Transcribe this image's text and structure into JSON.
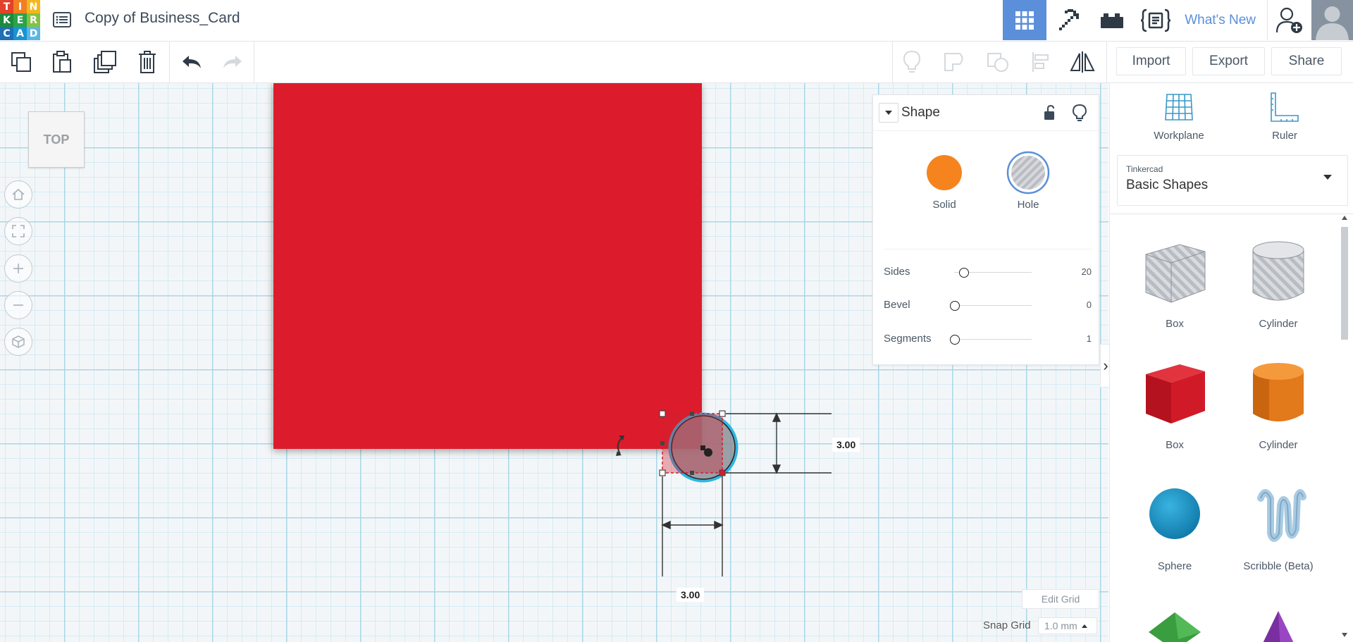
{
  "app": {
    "logo_letters": [
      "T",
      "I",
      "N",
      "K",
      "E",
      "R",
      "C",
      "A",
      "D"
    ],
    "logo_colors": [
      "#e2412a",
      "#f27f21",
      "#f3b81f",
      "#1d8a3b",
      "#2aa34a",
      "#84c341",
      "#1f6fb5",
      "#1993d3",
      "#5bb6e6"
    ],
    "title": "Copy of Business_Card"
  },
  "topbar": {
    "views": [
      {
        "name": "3d-design-view",
        "icon": "grid-icon",
        "active": true
      },
      {
        "name": "blocks-view",
        "icon": "pickaxe-icon",
        "active": false
      },
      {
        "name": "bricks-view",
        "icon": "brick-icon",
        "active": false
      },
      {
        "name": "codeblocks-view",
        "icon": "code-doc-icon",
        "active": false
      }
    ],
    "whats_new": "What's New",
    "accent": "#5b8fd9"
  },
  "toolbar": {
    "copy_icon": "copy-icon",
    "paste_icon": "paste-icon",
    "duplicate_icon": "duplicate-icon",
    "delete_icon": "trash-icon",
    "undo_icon": "undo-icon",
    "redo_icon": "redo-icon",
    "import_label": "Import",
    "export_label": "Export",
    "share_label": "Share"
  },
  "viewport": {
    "view_cube_label": "TOP",
    "dimension_height": "3.00",
    "dimension_width": "3.00",
    "edit_grid_label": "Edit Grid",
    "snap_grid_label": "Snap Grid",
    "snap_grid_value": "1.0 mm"
  },
  "inspector": {
    "title": "Shape",
    "solid_label": "Solid",
    "hole_label": "Hole",
    "solid_color": "#f5841f",
    "properties": [
      {
        "label": "Sides",
        "value": "20"
      },
      {
        "label": "Bevel",
        "value": "0"
      },
      {
        "label": "Segments",
        "value": "1"
      }
    ]
  },
  "rightpanel": {
    "workplane_label": "Workplane",
    "ruler_label": "Ruler",
    "library_small": "Tinkercad",
    "library_name": "Basic Shapes",
    "shapes": [
      {
        "label": "Box",
        "icon": "box-hole-icon"
      },
      {
        "label": "Cylinder",
        "icon": "cylinder-hole-icon"
      },
      {
        "label": "Box",
        "icon": "box-solid-icon"
      },
      {
        "label": "Cylinder",
        "icon": "cylinder-solid-icon"
      },
      {
        "label": "Sphere",
        "icon": "sphere-icon"
      },
      {
        "label": "Scribble (Beta)",
        "icon": "scribble-icon"
      }
    ]
  }
}
